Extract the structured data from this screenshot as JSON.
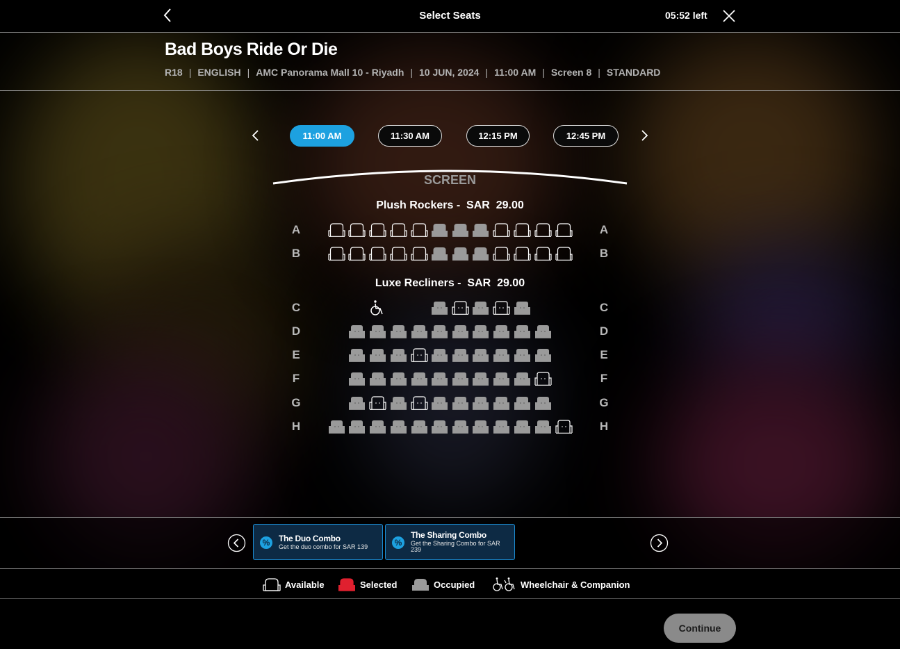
{
  "header": {
    "title": "Select Seats",
    "timer": "05:52 left"
  },
  "movie": {
    "title": "Bad Boys Ride Or Die",
    "meta": [
      "R18",
      "ENGLISH",
      "AMC Panorama Mall 10 - Riyadh",
      "10 JUN, 2024",
      "11:00 AM",
      "Screen 8",
      "STANDARD"
    ]
  },
  "showtimes": [
    {
      "label": "11:00 AM",
      "active": true
    },
    {
      "label": "11:30 AM",
      "active": false
    },
    {
      "label": "12:15 PM",
      "active": false
    },
    {
      "label": "12:45 PM",
      "active": false
    }
  ],
  "screen_label": "SCREEN",
  "sections": [
    {
      "name": "Plush Rockers -",
      "currency": "SAR",
      "price": "29.00"
    },
    {
      "name": "Luxe Recliners -",
      "currency": "SAR",
      "price": "29.00"
    }
  ],
  "rows": [
    "A",
    "B",
    "C",
    "D",
    "E",
    "F",
    "G",
    "H"
  ],
  "combos": [
    {
      "title": "The Duo Combo",
      "desc": "Get the duo combo for SAR 139",
      "icon": "percent-icon"
    },
    {
      "title": "The Sharing Combo",
      "desc": "Get the Sharing Combo for SAR 239",
      "icon": "percent-icon"
    }
  ],
  "legend": {
    "available": "Available",
    "selected": "Selected",
    "occupied": "Occupied",
    "wheelchair": "Wheelchair & Companion"
  },
  "colors": {
    "accent": "#1da1e0",
    "selected": "#e0202f",
    "occupied": "#9a9a9a",
    "available": "#ffffff"
  },
  "continue_label": "Continue"
}
